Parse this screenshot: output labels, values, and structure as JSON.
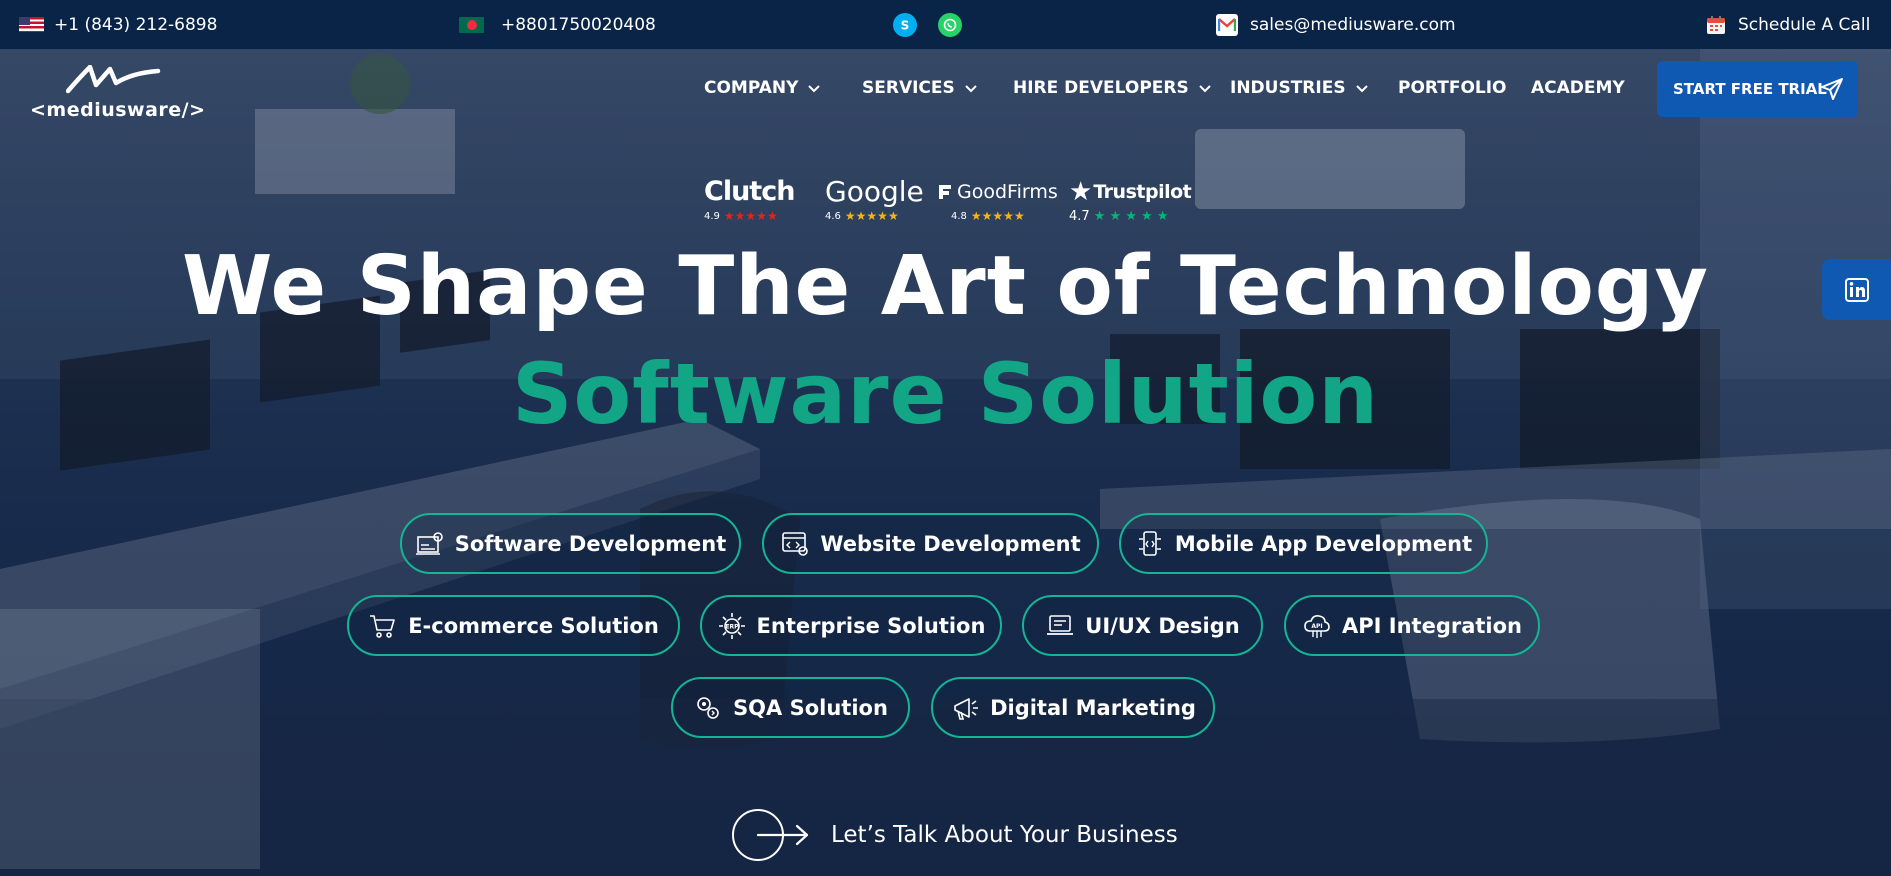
{
  "topbar": {
    "us_phone": "+1 (843) 212-6898",
    "bd_phone": "+8801750020408",
    "email": "sales@mediusware.com",
    "schedule": "Schedule A Call",
    "icons": [
      "us-flag-icon",
      "bangladesh-flag-icon",
      "skype-icon",
      "whatsapp-icon",
      "gmail-icon",
      "calendar-icon"
    ]
  },
  "brand": {
    "logo_text": "<mediusware/>"
  },
  "nav": {
    "items": [
      {
        "label": "COMPANY",
        "has_dropdown": true
      },
      {
        "label": "SERVICES",
        "has_dropdown": true
      },
      {
        "label": "HIRE DEVELOPERS",
        "has_dropdown": true
      },
      {
        "label": "INDUSTRIES",
        "has_dropdown": true
      },
      {
        "label": "PORTFOLIO",
        "has_dropdown": false
      },
      {
        "label": "ACADEMY",
        "has_dropdown": false
      }
    ],
    "cta_label": "START FREE TRIAL"
  },
  "ratings": [
    {
      "brand": "Clutch",
      "score": "4.9",
      "stars": "★★★★★",
      "star_color": "#e62415"
    },
    {
      "brand": "Google",
      "score": "4.6",
      "stars": "★★★★★",
      "star_color": "#f6b50e"
    },
    {
      "brand": "GoodFirms",
      "score": "4.8",
      "stars": "★★★★★",
      "star_color": "#f6b50e"
    },
    {
      "brand": "Trustpilot",
      "score": "4.7",
      "stars": "★ ★ ★ ★ ★",
      "star_color": "#00b67a"
    }
  ],
  "hero": {
    "headline": "We Shape The Art of Technology",
    "subline": "Software Solution"
  },
  "services": [
    {
      "label": "Software Development",
      "icon": "software-development-icon"
    },
    {
      "label": "Website Development",
      "icon": "website-development-icon"
    },
    {
      "label": "Mobile App Development",
      "icon": "mobile-app-icon"
    },
    {
      "label": "E-commerce Solution",
      "icon": "shopping-cart-icon"
    },
    {
      "label": "Enterprise Solution",
      "icon": "erp-gear-icon"
    },
    {
      "label": "UI/UX Design",
      "icon": "laptop-design-icon"
    },
    {
      "label": "API Integration",
      "icon": "api-cloud-icon"
    },
    {
      "label": "SQA Solution",
      "icon": "sqa-gears-icon"
    },
    {
      "label": "Digital Marketing",
      "icon": "megaphone-icon"
    }
  ],
  "talk": {
    "label": "Let’s Talk About Your Business"
  },
  "colors": {
    "topbar_bg": "#0a2447",
    "accent_green": "#12a686",
    "pill_border": "#14b594",
    "cta_blue": "#1059b3"
  }
}
